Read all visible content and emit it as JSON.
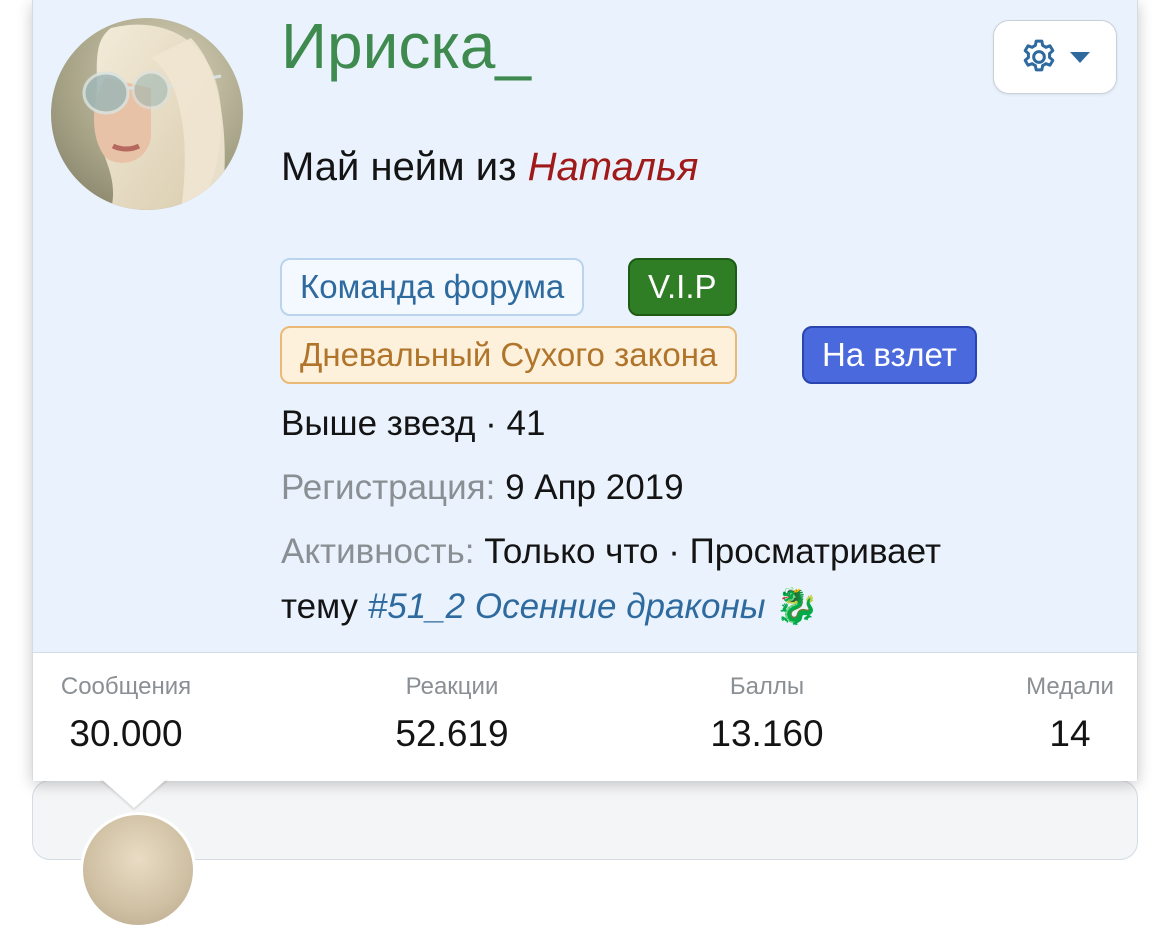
{
  "profile": {
    "username": "Ириска_",
    "title_prefix": "Май нейм из",
    "title_name": "Наталья",
    "banners": {
      "team": "Команда форума",
      "vip": "V.I.P",
      "duty": "Дневальный Сухого закона",
      "fly": "На взлет"
    },
    "rank": "Выше звезд · 41",
    "registration_label": "Регистрация:",
    "registration_value": "9 Апр 2019",
    "activity_label": "Активность:",
    "activity_value": "Только что · Просматривает",
    "activity_prefix": "тему",
    "activity_thread": "#51_2 Осенние драконы",
    "activity_emoji": "🐉"
  },
  "settings_menu": {
    "icon": "gear-icon",
    "caret_icon": "caret-down-icon"
  },
  "stats": [
    {
      "label": "Сообщения",
      "value": "30.000"
    },
    {
      "label": "Реакции",
      "value": "52.619"
    },
    {
      "label": "Баллы",
      "value": "13.160"
    },
    {
      "label": "Медали",
      "value": "14"
    }
  ],
  "colors": {
    "username": "#3f8a4f",
    "title_name": "#a01a1a",
    "link": "#2f6a9f",
    "popup_bg": "#eaf3fd",
    "vip_banner": "#2f7d24",
    "fly_banner": "#4a69dd",
    "duty_banner_text": "#b0752a"
  }
}
